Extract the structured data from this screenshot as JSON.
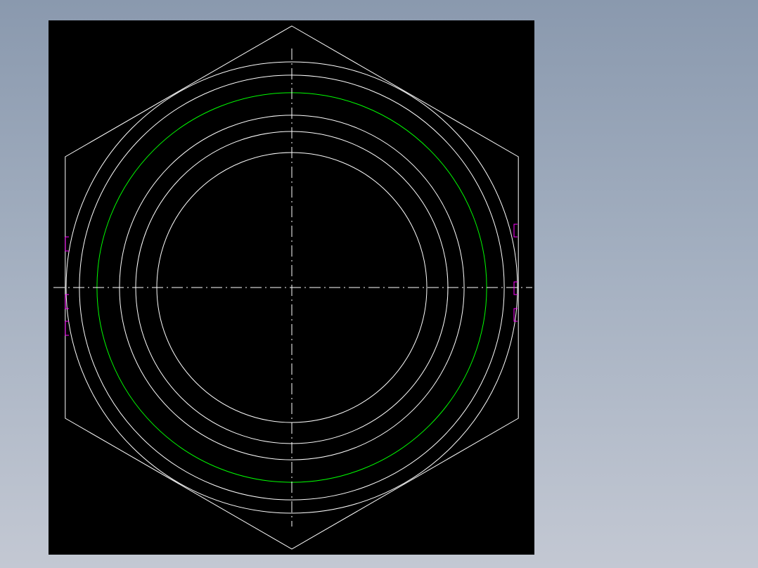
{
  "colors": {
    "background_gradient_top": "#8a99ae",
    "background_gradient_bottom": "#c3c8d3",
    "viewport_background": "#000000",
    "geometry_line": "#ffffff",
    "highlight_circle": "#00ff00",
    "center_line": "#ffffff",
    "thread_marker": "#ff00ff"
  },
  "drawing": {
    "view": "top-view-hex-nut",
    "hexagon": {
      "orientation": "pointy-top"
    },
    "concentric_circles": [
      {
        "id": "outer-1",
        "color_key": "geometry_line",
        "relative_radius": 1.0
      },
      {
        "id": "outer-2",
        "color_key": "geometry_line",
        "relative_radius": 0.9412
      },
      {
        "id": "pitch",
        "color_key": "highlight_circle",
        "relative_radius": 0.8633
      },
      {
        "id": "inner-1",
        "color_key": "geometry_line",
        "relative_radius": 0.7637
      },
      {
        "id": "inner-2",
        "color_key": "geometry_line",
        "relative_radius": 0.6916
      },
      {
        "id": "bore",
        "color_key": "geometry_line",
        "relative_radius": 0.5981
      }
    ],
    "center_lines": {
      "style": "dash-dot"
    },
    "edge_markers": {
      "count_per_side": 3,
      "color_key": "thread_marker"
    }
  }
}
